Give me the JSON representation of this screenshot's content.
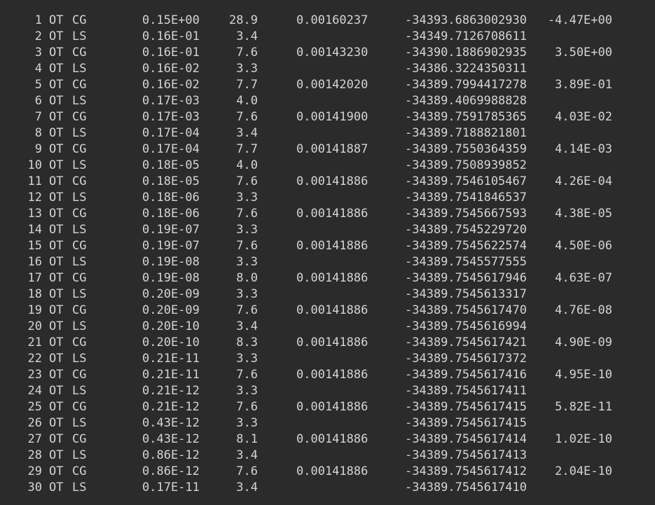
{
  "rows": [
    {
      "step": "1",
      "ot": "OT",
      "type": "CG",
      "grad": "0.15E+00",
      "time": "28.9",
      "conv": "0.00160237",
      "energy": "-34393.6863002930",
      "change": "-4.47E+00"
    },
    {
      "step": "2",
      "ot": "OT",
      "type": "LS",
      "grad": "0.16E-01",
      "time": "3.4",
      "conv": "",
      "energy": "-34349.7126708611",
      "change": ""
    },
    {
      "step": "3",
      "ot": "OT",
      "type": "CG",
      "grad": "0.16E-01",
      "time": "7.6",
      "conv": "0.00143230",
      "energy": "-34390.1886902935",
      "change": "3.50E+00"
    },
    {
      "step": "4",
      "ot": "OT",
      "type": "LS",
      "grad": "0.16E-02",
      "time": "3.3",
      "conv": "",
      "energy": "-34386.3224350311",
      "change": ""
    },
    {
      "step": "5",
      "ot": "OT",
      "type": "CG",
      "grad": "0.16E-02",
      "time": "7.7",
      "conv": "0.00142020",
      "energy": "-34389.7994417278",
      "change": "3.89E-01"
    },
    {
      "step": "6",
      "ot": "OT",
      "type": "LS",
      "grad": "0.17E-03",
      "time": "4.0",
      "conv": "",
      "energy": "-34389.4069988828",
      "change": ""
    },
    {
      "step": "7",
      "ot": "OT",
      "type": "CG",
      "grad": "0.17E-03",
      "time": "7.6",
      "conv": "0.00141900",
      "energy": "-34389.7591785365",
      "change": "4.03E-02"
    },
    {
      "step": "8",
      "ot": "OT",
      "type": "LS",
      "grad": "0.17E-04",
      "time": "3.4",
      "conv": "",
      "energy": "-34389.7188821801",
      "change": ""
    },
    {
      "step": "9",
      "ot": "OT",
      "type": "CG",
      "grad": "0.17E-04",
      "time": "7.7",
      "conv": "0.00141887",
      "energy": "-34389.7550364359",
      "change": "4.14E-03"
    },
    {
      "step": "10",
      "ot": "OT",
      "type": "LS",
      "grad": "0.18E-05",
      "time": "4.0",
      "conv": "",
      "energy": "-34389.7508939852",
      "change": ""
    },
    {
      "step": "11",
      "ot": "OT",
      "type": "CG",
      "grad": "0.18E-05",
      "time": "7.6",
      "conv": "0.00141886",
      "energy": "-34389.7546105467",
      "change": "4.26E-04"
    },
    {
      "step": "12",
      "ot": "OT",
      "type": "LS",
      "grad": "0.18E-06",
      "time": "3.3",
      "conv": "",
      "energy": "-34389.7541846537",
      "change": ""
    },
    {
      "step": "13",
      "ot": "OT",
      "type": "CG",
      "grad": "0.18E-06",
      "time": "7.6",
      "conv": "0.00141886",
      "energy": "-34389.7545667593",
      "change": "4.38E-05"
    },
    {
      "step": "14",
      "ot": "OT",
      "type": "LS",
      "grad": "0.19E-07",
      "time": "3.3",
      "conv": "",
      "energy": "-34389.7545229720",
      "change": ""
    },
    {
      "step": "15",
      "ot": "OT",
      "type": "CG",
      "grad": "0.19E-07",
      "time": "7.6",
      "conv": "0.00141886",
      "energy": "-34389.7545622574",
      "change": "4.50E-06"
    },
    {
      "step": "16",
      "ot": "OT",
      "type": "LS",
      "grad": "0.19E-08",
      "time": "3.3",
      "conv": "",
      "energy": "-34389.7545577555",
      "change": ""
    },
    {
      "step": "17",
      "ot": "OT",
      "type": "CG",
      "grad": "0.19E-08",
      "time": "8.0",
      "conv": "0.00141886",
      "energy": "-34389.7545617946",
      "change": "4.63E-07"
    },
    {
      "step": "18",
      "ot": "OT",
      "type": "LS",
      "grad": "0.20E-09",
      "time": "3.3",
      "conv": "",
      "energy": "-34389.7545613317",
      "change": ""
    },
    {
      "step": "19",
      "ot": "OT",
      "type": "CG",
      "grad": "0.20E-09",
      "time": "7.6",
      "conv": "0.00141886",
      "energy": "-34389.7545617470",
      "change": "4.76E-08"
    },
    {
      "step": "20",
      "ot": "OT",
      "type": "LS",
      "grad": "0.20E-10",
      "time": "3.4",
      "conv": "",
      "energy": "-34389.7545616994",
      "change": ""
    },
    {
      "step": "21",
      "ot": "OT",
      "type": "CG",
      "grad": "0.20E-10",
      "time": "8.3",
      "conv": "0.00141886",
      "energy": "-34389.7545617421",
      "change": "4.90E-09"
    },
    {
      "step": "22",
      "ot": "OT",
      "type": "LS",
      "grad": "0.21E-11",
      "time": "3.3",
      "conv": "",
      "energy": "-34389.7545617372",
      "change": ""
    },
    {
      "step": "23",
      "ot": "OT",
      "type": "CG",
      "grad": "0.21E-11",
      "time": "7.6",
      "conv": "0.00141886",
      "energy": "-34389.7545617416",
      "change": "4.95E-10"
    },
    {
      "step": "24",
      "ot": "OT",
      "type": "LS",
      "grad": "0.21E-12",
      "time": "3.3",
      "conv": "",
      "energy": "-34389.7545617411",
      "change": ""
    },
    {
      "step": "25",
      "ot": "OT",
      "type": "CG",
      "grad": "0.21E-12",
      "time": "7.6",
      "conv": "0.00141886",
      "energy": "-34389.7545617415",
      "change": "5.82E-11"
    },
    {
      "step": "26",
      "ot": "OT",
      "type": "LS",
      "grad": "0.43E-12",
      "time": "3.3",
      "conv": "",
      "energy": "-34389.7545617415",
      "change": ""
    },
    {
      "step": "27",
      "ot": "OT",
      "type": "CG",
      "grad": "0.43E-12",
      "time": "8.1",
      "conv": "0.00141886",
      "energy": "-34389.7545617414",
      "change": "1.02E-10"
    },
    {
      "step": "28",
      "ot": "OT",
      "type": "LS",
      "grad": "0.86E-12",
      "time": "3.4",
      "conv": "",
      "energy": "-34389.7545617413",
      "change": ""
    },
    {
      "step": "29",
      "ot": "OT",
      "type": "CG",
      "grad": "0.86E-12",
      "time": "7.6",
      "conv": "0.00141886",
      "energy": "-34389.7545617412",
      "change": "2.04E-10"
    },
    {
      "step": "30",
      "ot": "OT",
      "type": "LS",
      "grad": "0.17E-11",
      "time": "3.4",
      "conv": "",
      "energy": "-34389.7545617410",
      "change": ""
    }
  ]
}
